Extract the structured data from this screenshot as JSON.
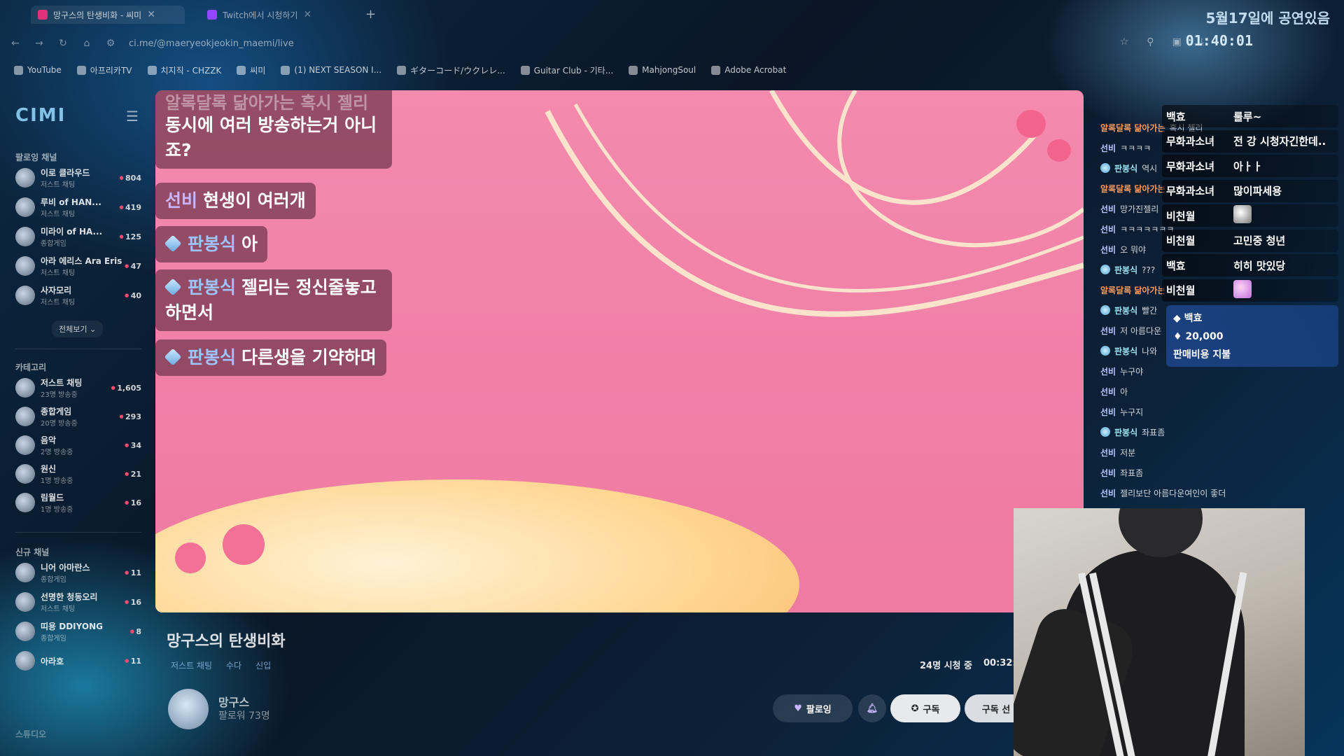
{
  "browser": {
    "tabs": [
      {
        "title": "망구스의 탄생비화 - 씨미"
      },
      {
        "title": "Twitch에서 시청하기"
      }
    ],
    "url": "ci.me/@maeryeokjeokin_maemi/live",
    "bookmarks": [
      "YouTube",
      "아프리카TV",
      "치지직 - CHZZK",
      "씨미",
      "(1) NEXT SEASON I...",
      "ギターコード/ウクレレ...",
      "Guitar Club - 기타...",
      "MahjongSoul",
      "Adobe Acrobat"
    ],
    "overlay_date": "5월17일에 공연있음",
    "overlay_time": "01:40:01"
  },
  "sidebar": {
    "logo": "CIMI",
    "followed_title": "팔로잉 채널",
    "followed": [
      {
        "name": "이로 클라우드",
        "category": "저스트 채팅",
        "viewers": "804"
      },
      {
        "name": "루비 of HAN...",
        "category": "저스트 채팅",
        "viewers": "419"
      },
      {
        "name": "미라이 of HA...",
        "category": "종합게임",
        "viewers": "125"
      },
      {
        "name": "아라 에리스 Ara Eris",
        "category": "저스트 채팅",
        "viewers": "47"
      },
      {
        "name": "사자모리",
        "category": "저스트 채팅",
        "viewers": "40"
      }
    ],
    "see_all": "전체보기 ⌄",
    "category_title": "카테고리",
    "categories": [
      {
        "name": "저스트 채팅",
        "count": "23명 방송중",
        "viewers": "1,605"
      },
      {
        "name": "종합게임",
        "count": "20명 방송중",
        "viewers": "293"
      },
      {
        "name": "음악",
        "count": "2명 방송중",
        "viewers": "34"
      },
      {
        "name": "원신",
        "count": "1명 방송중",
        "viewers": "21"
      },
      {
        "name": "림월드",
        "count": "1명 방송중",
        "viewers": "16"
      }
    ],
    "new_title": "신규 채널",
    "new_channels": [
      {
        "name": "니어 아마란스",
        "category": "종합게임",
        "viewers": "11"
      },
      {
        "name": "선명한 청동오리",
        "category": "저스트 채팅",
        "viewers": "16"
      },
      {
        "name": "띠용 DDIYONG",
        "category": "종합게임",
        "viewers": "8"
      },
      {
        "name": "아라호",
        "category": "",
        "viewers": "11"
      }
    ],
    "studio": "스튜디오"
  },
  "video_chat": [
    {
      "user": "",
      "text": "동시에 여러 방송하는거 아니\n죠?",
      "top_faded": "알록달록 닮아가는 혹시 젤리"
    },
    {
      "user": "선비",
      "text": "현생이 여러개"
    },
    {
      "user": "판봉식",
      "text": "아"
    },
    {
      "user": "판봉식",
      "text": "젤리는 정신줄놓고\n하면서"
    },
    {
      "user": "판봉식",
      "text": "다른생을 기약하며"
    }
  ],
  "stream": {
    "title": "망구스의 탄생비화",
    "tags": [
      "저스트 채팅",
      "수다",
      "신입"
    ],
    "viewers": "24명 시청 중",
    "elapsed": "00:32:",
    "streamer": "망구스",
    "followers": "팔로워 73명",
    "follow_label": "팔로잉",
    "subscribe_label": "구독",
    "gift_label": "구독 선"
  },
  "chat_log": [
    {
      "user": "알록달록 닮아가는",
      "text": "혹시 젤리",
      "style": "orange"
    },
    {
      "user": "선비",
      "text": "ㅋㅋㅋㅋ",
      "style": "blue"
    },
    {
      "user": "판봉식",
      "text": "역시",
      "style": "teal"
    },
    {
      "user": "알록달록 닮아가는",
      "text": "",
      "style": "orange"
    },
    {
      "user": "선비",
      "text": "망가진젤리",
      "style": "blue"
    },
    {
      "user": "선비",
      "text": "ㅋㅋㅋㅋㅋㅋㅋ",
      "style": "blue"
    },
    {
      "user": "선비",
      "text": "오 뭐야",
      "style": "blue"
    },
    {
      "user": "판봉식",
      "text": "???",
      "style": "teal"
    },
    {
      "user": "알록달록 닮아가는",
      "text": "",
      "style": "orange"
    },
    {
      "user": "판봉식",
      "text": "빨간",
      "style": "teal"
    },
    {
      "user": "선비",
      "text": "저 아름다운",
      "style": "blue"
    },
    {
      "user": "판봉식",
      "text": "나와",
      "style": "teal"
    },
    {
      "user": "선비",
      "text": "누구야",
      "style": "blue"
    },
    {
      "user": "선비",
      "text": "아",
      "style": "blue"
    },
    {
      "user": "선비",
      "text": "누구지",
      "style": "blue"
    },
    {
      "user": "판봉식",
      "text": "좌표좀",
      "style": "teal"
    },
    {
      "user": "선비",
      "text": "저분",
      "style": "blue"
    },
    {
      "user": "선비",
      "text": "좌표좀",
      "style": "blue"
    },
    {
      "user": "선비",
      "text": "젤리보단 아름다운여인이 좋더",
      "style": "blue"
    }
  ],
  "donation_overlay": [
    {
      "name": "백효",
      "msg": "룰루~"
    },
    {
      "name": "무화과소녀",
      "msg": "전 강 시청자긴한데.."
    },
    {
      "name": "무화과소녀",
      "msg": "아ㅏㅏ"
    },
    {
      "name": "무화과소녀",
      "msg": "많이파세용"
    },
    {
      "name": "비천월",
      "msg": ""
    },
    {
      "name": "비천월",
      "msg": "고민중 청년"
    },
    {
      "name": "백효",
      "msg": "히히 맛있당"
    },
    {
      "name": "비천월",
      "msg": ""
    }
  ],
  "donation_box": {
    "name": "백효",
    "amount": "20,000",
    "message": "판매비용 지불"
  },
  "colors": {
    "video_bg": "#f07fa6",
    "accent": "#b7a5ff"
  }
}
